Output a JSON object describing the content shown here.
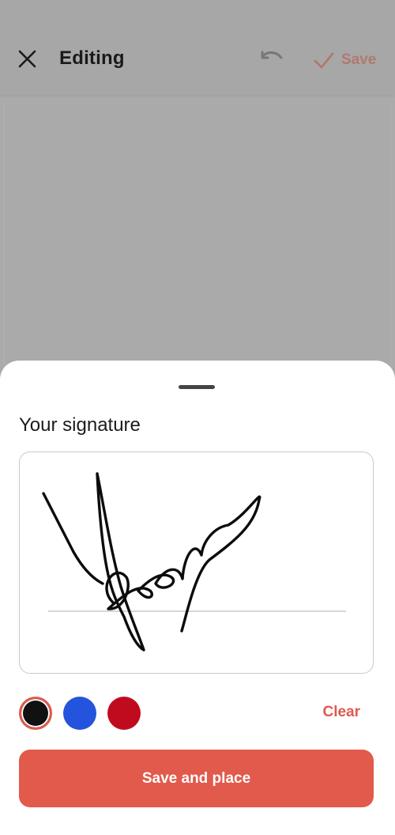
{
  "header": {
    "title": "Editing",
    "save_label": "Save",
    "close_icon": "close-icon",
    "undo_icon": "undo-icon",
    "check_icon": "check-icon"
  },
  "sheet": {
    "title": "Your signature",
    "clear_label": "Clear",
    "primary_label": "Save and place",
    "colors": [
      {
        "name": "black",
        "hex": "#111111",
        "selected": true
      },
      {
        "name": "blue",
        "hex": "#2453dd",
        "selected": false
      },
      {
        "name": "red",
        "hex": "#c00b1f",
        "selected": false
      }
    ],
    "accent": "#e15a4b"
  }
}
